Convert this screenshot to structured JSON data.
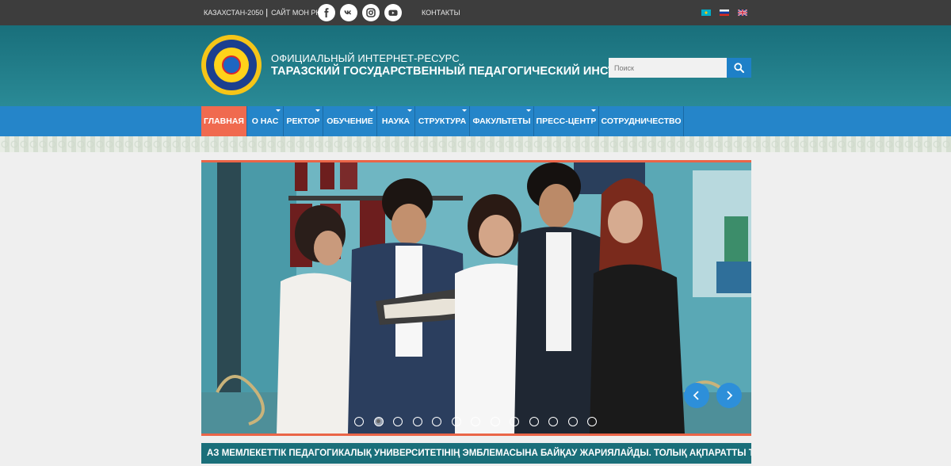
{
  "topbar": {
    "kz2050": "КАЗАХСТАН-2050",
    "mon": "САЙТ МОН РК",
    "social": [
      "facebook-icon",
      "vk-icon",
      "instagram-icon",
      "youtube-icon"
    ],
    "contacts": "КОНТАКТЫ",
    "languages": [
      "kz",
      "ru",
      "en"
    ]
  },
  "header": {
    "subtitle": "ОФИЦИАЛЬНЫЙ ИНТЕРНЕТ-РЕСУРС",
    "title": "ТАРАЗСКИЙ ГОСУДАРСТВЕННЫЙ ПЕДАГОГИЧЕСКИЙ ИНСТИТУТ",
    "search_placeholder": "Поиск"
  },
  "nav": {
    "items": [
      {
        "label": "ГЛАВНАЯ",
        "active": true,
        "dropdown": false
      },
      {
        "label": "О НАС",
        "dropdown": true
      },
      {
        "label": "РЕКТОР",
        "dropdown": true
      },
      {
        "label": "ОБУЧЕНИЕ",
        "dropdown": true
      },
      {
        "label": "НАУКА",
        "dropdown": true
      },
      {
        "label": "СТРУКТУРА",
        "dropdown": true
      },
      {
        "label": "ФАКУЛЬТЕТЫ",
        "dropdown": true
      },
      {
        "label": "ПРЕСС-ЦЕНТР",
        "dropdown": true
      },
      {
        "label": "СОТРУДНИЧЕСТВО",
        "dropdown": false
      }
    ]
  },
  "slider": {
    "slide_count": 13,
    "active_index": 1
  },
  "ticker": {
    "text": "АЗ МЕМЛЕКЕТТІК ПЕДАГОГИКАЛЫҚ УНИВЕРСИТЕТІНІҢ ЭМБЛЕМАСЫНА БАЙҚАУ ЖАРИЯЛАЙДЫ. ТОЛЫҚ АҚПАРАТТЫ ТӘРБИЕ БӨЛІМІНЕ"
  },
  "colors": {
    "topbar": "#3d3d3d",
    "header": "#1d7581",
    "nav": "#2585c9",
    "nav_active": "#f06a4f",
    "accent": "#ea6548"
  }
}
